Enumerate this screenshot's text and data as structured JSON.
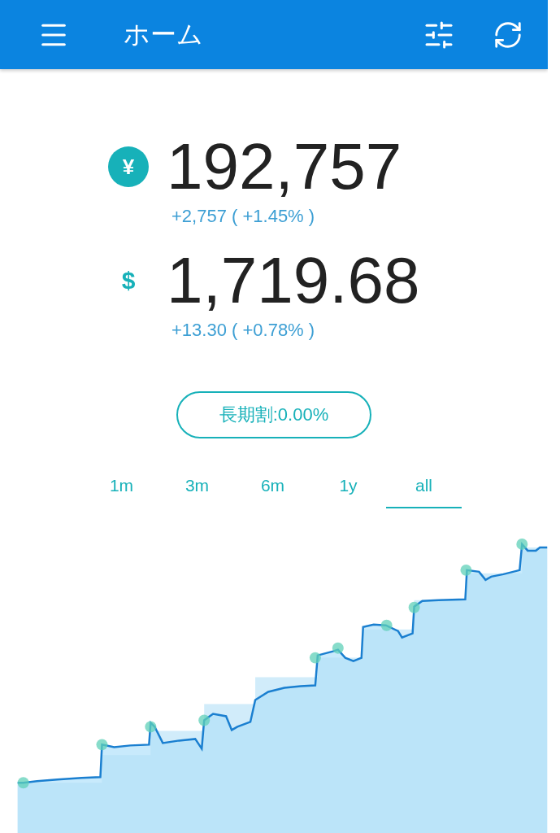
{
  "app_bar": {
    "title": "ホーム"
  },
  "balances": [
    {
      "kind": "badge",
      "symbol": "¥",
      "amount": "192,757",
      "change": "+2,757 ( +1.45% )"
    },
    {
      "kind": "plain",
      "symbol": "$",
      "amount": "1,719.68",
      "change": "+13.30 ( +0.78% )"
    }
  ],
  "discount_button": {
    "label": "長期割:0.00%"
  },
  "range_tabs": [
    {
      "label": "1m",
      "selected": false
    },
    {
      "label": "3m",
      "selected": false
    },
    {
      "label": "6m",
      "selected": false
    },
    {
      "label": "1y",
      "selected": false
    },
    {
      "label": "all",
      "selected": true
    }
  ]
}
